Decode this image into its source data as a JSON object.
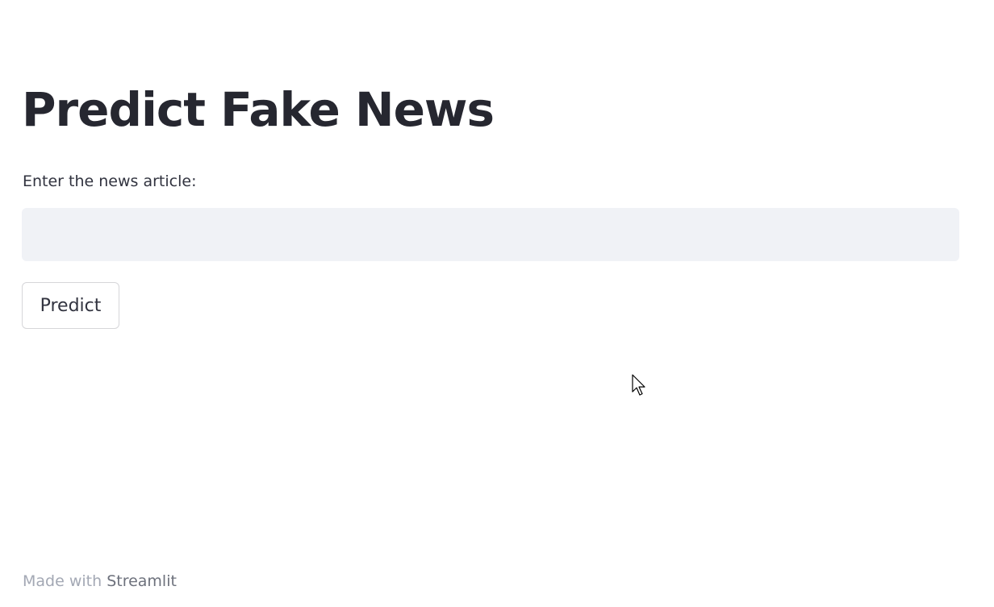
{
  "main": {
    "title": "Predict Fake News",
    "input_label": "Enter the news article:",
    "input_value": "",
    "predict_button_label": "Predict"
  },
  "footer": {
    "prefix": "Made with",
    "link_label": "Streamlit"
  },
  "colors": {
    "title": "#262730",
    "text": "#31333f",
    "input_background": "#f0f2f6",
    "button_border": "#d6d6d9",
    "footer_text": "#a3a8b4"
  },
  "icons": {
    "cursor": "mouse-pointer-icon"
  }
}
